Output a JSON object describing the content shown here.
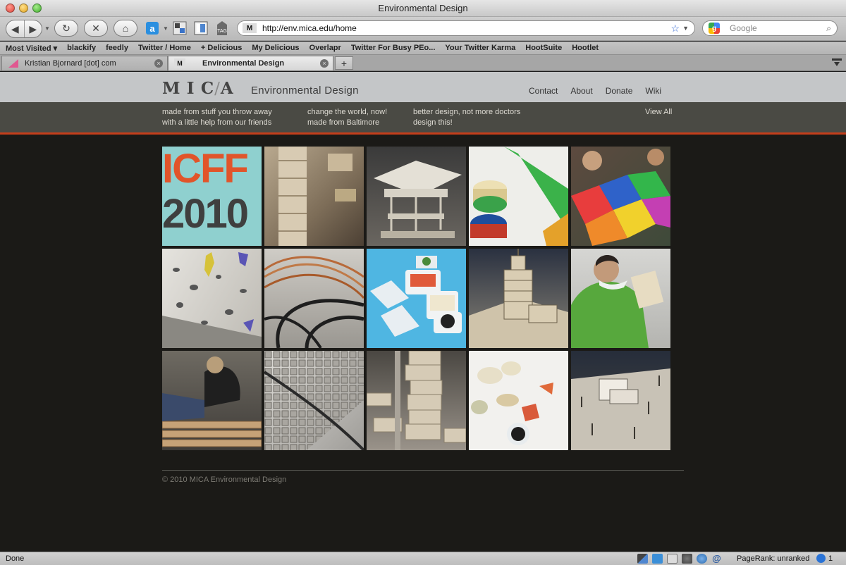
{
  "window": {
    "title": "Environmental Design"
  },
  "toolbar": {
    "back_icon": "back-arrow-icon",
    "forward_icon": "forward-arrow-icon",
    "reload_icon": "reload-icon",
    "stop_icon": "stop-icon",
    "home_icon": "home-icon",
    "tag_label": "TAG",
    "url": "http://env.mica.edu/home",
    "site_favicon": "M",
    "search_placeholder": "Google"
  },
  "bookmarks": [
    "Most Visited ▾",
    "blackify",
    "feedly",
    "Twitter / Home",
    "+ Delicious",
    "My Delicious",
    "Overlapr",
    "Twitter For Busy PEo...",
    "Your Twitter Karma",
    "HootSuite",
    "Hootlet"
  ],
  "tabs": [
    {
      "label": "Kristian Bjornard [dot] com",
      "active": false
    },
    {
      "label": "Environmental Design",
      "active": true
    }
  ],
  "site": {
    "logo": {
      "a": "M",
      "b": "I",
      "c": "C",
      "d": "A"
    },
    "title": "Environmental Design",
    "nav": [
      "Contact",
      "About",
      "Donate",
      "Wiki"
    ],
    "projects": [
      {
        "line1": "made from stuff you throw away",
        "line2": "with a little help from our friends"
      },
      {
        "line1": "change the world, now!",
        "line2": "made from Baltimore"
      },
      {
        "line1": "better design, not more doctors",
        "line2": "design this!"
      }
    ],
    "view_all": "View All",
    "icff": {
      "line1": "ICFF",
      "line2": "2010"
    },
    "footer": "© 2010 MICA Environmental Design"
  },
  "status": {
    "left": "Done",
    "pagerank": "PageRank: unranked",
    "count": "1"
  },
  "colors": {
    "accent": "#c43e1b",
    "subnav_bg": "#4a4a44",
    "header_bg": "#c4c6c8",
    "page_bg": "#1b1a17"
  }
}
